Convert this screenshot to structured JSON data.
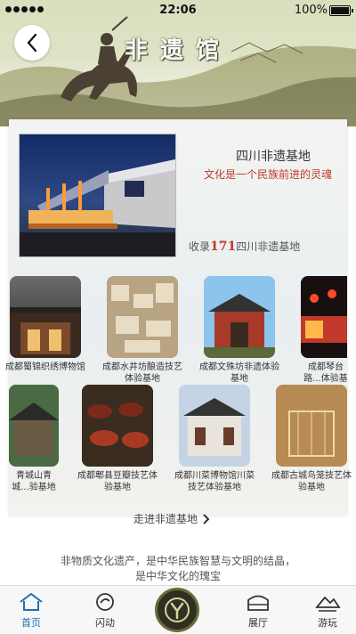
{
  "status_bar": {
    "time": "22:06",
    "battery": "100%"
  },
  "header": {
    "title": "非遗馆"
  },
  "base": {
    "title": "四川非遗基地",
    "slogan": "文化是一个民族前进的灵魂",
    "count_prefix": "收录",
    "count": "171",
    "count_suffix": "四川非遗基地"
  },
  "tiles_row1": [
    {
      "label": "成都蜀锦织绣博物馆"
    },
    {
      "label": "成都水井坊酿造技艺体验基地"
    },
    {
      "label": "成都文殊坊非遗体验基地"
    },
    {
      "label": "成都琴台路...体验基"
    }
  ],
  "tiles_row2": [
    {
      "label": "青城山青城...验基地"
    },
    {
      "label": "成都郫县豆瓣技艺体验基地"
    },
    {
      "label": "成都川菜博物馆川菜技艺体验基地"
    },
    {
      "label": "成都古城鸟笼技艺体验基地"
    }
  ],
  "more_link": "走进非遗基地",
  "footer_text_line1": "非物质文化遗产，是中华民族智慧与文明的结晶，",
  "footer_text_line2": "是中华文化的瑰宝",
  "tabbar": {
    "home": "首页",
    "flash": "闪动",
    "hall": "展厅",
    "play": "游玩"
  },
  "colors": {
    "accent": "#c0392b",
    "tab_active": "#1f6fb5",
    "center": "#2f2f22"
  }
}
